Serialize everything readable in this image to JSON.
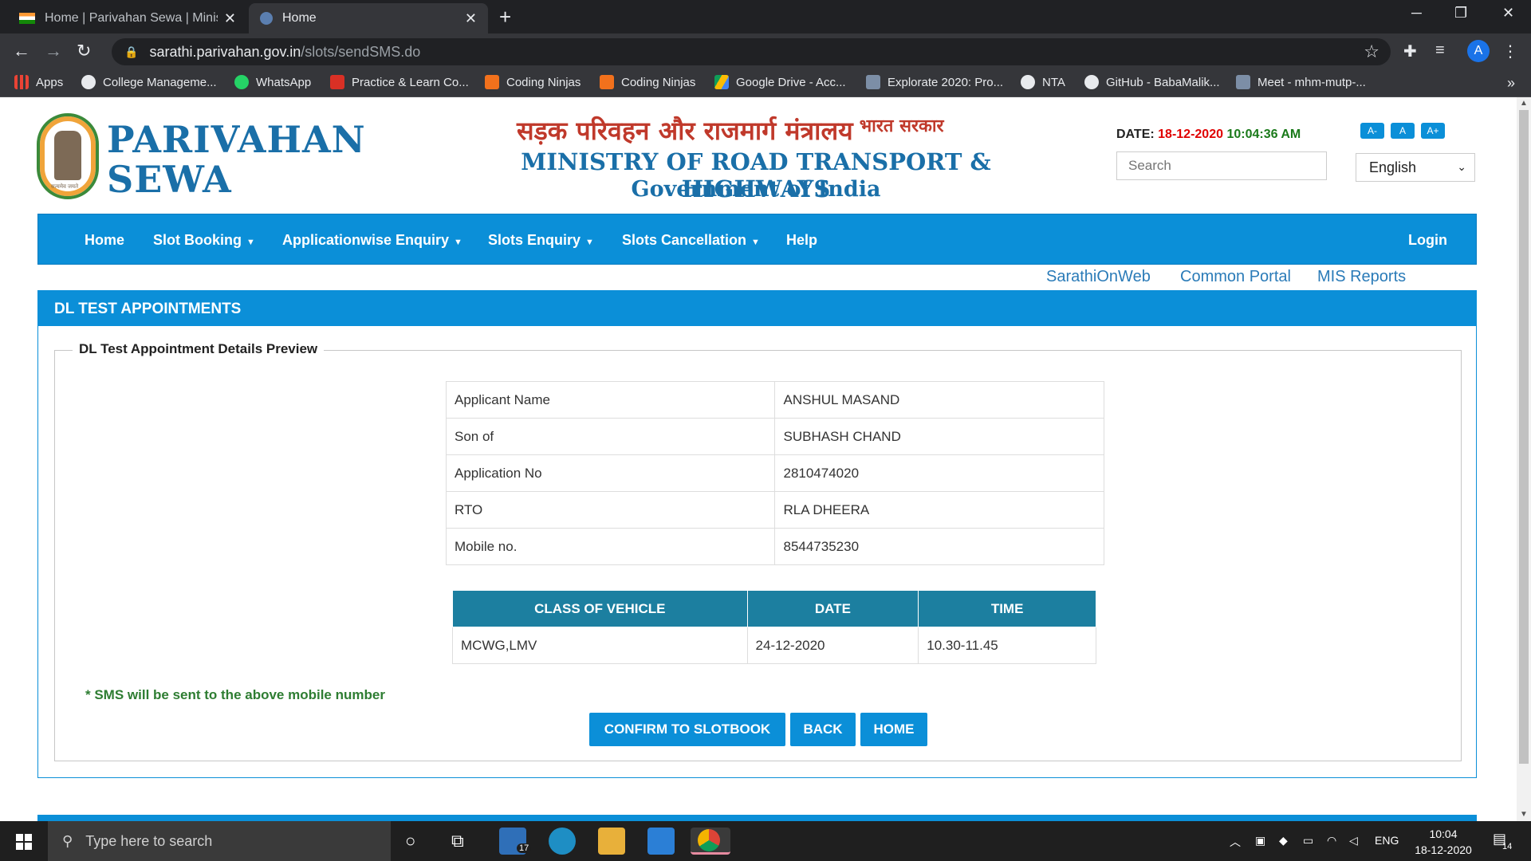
{
  "browser": {
    "tabs": [
      {
        "title": "Home | Parivahan Sewa | Ministry",
        "active": false
      },
      {
        "title": "Home",
        "active": true
      }
    ],
    "url_host": "sarathi.parivahan.gov.in",
    "url_path": "/slots/sendSMS.do",
    "avatar_letter": "A",
    "bookmarks": [
      {
        "label": "Apps",
        "color": "#ea4335"
      },
      {
        "label": "College Manageme...",
        "color": "#e8eaed"
      },
      {
        "label": "WhatsApp",
        "color": "#25d366"
      },
      {
        "label": "Practice & Learn Co...",
        "color": "#d93025"
      },
      {
        "label": "Coding Ninjas",
        "color": "#f2711c"
      },
      {
        "label": "Coding Ninjas",
        "color": "#f2711c"
      },
      {
        "label": "Google Drive - Acc...",
        "color": "#fbbc04"
      },
      {
        "label": "Explorate 2020: Pro...",
        "color": "#7c8ea6"
      },
      {
        "label": "NTA",
        "color": "#e8eaed"
      },
      {
        "label": "GitHub - BabaMalik...",
        "color": "#e8eaed"
      },
      {
        "label": "Meet - mhm-mutp-...",
        "color": "#7c8ea6"
      }
    ]
  },
  "header": {
    "brand_line1": "PARIVAHAN",
    "brand_line2": "SEWA",
    "logo_motto": "सत्यमेव जयते",
    "ministry_hindi": "सड़क परिवहन और राजमार्ग मंत्रालय",
    "ministry_hindi_small": "भारत सरकार",
    "ministry_english": "MINISTRY OF ROAD TRANSPORT & HIGHWAYS",
    "government": "Government of India",
    "date_label": "DATE:",
    "date_value": "18-12-2020",
    "time_value": "10:04:36 AM",
    "font_buttons": [
      "A-",
      "A",
      "A+"
    ],
    "search_placeholder": "Search",
    "language": "English"
  },
  "nav": {
    "items": [
      {
        "label": "Home",
        "dropdown": false
      },
      {
        "label": "Slot Booking",
        "dropdown": true
      },
      {
        "label": "Applicationwise Enquiry",
        "dropdown": true
      },
      {
        "label": "Slots Enquiry",
        "dropdown": true
      },
      {
        "label": "Slots Cancellation",
        "dropdown": true
      },
      {
        "label": "Help",
        "dropdown": false
      }
    ],
    "login": "Login",
    "sublinks": [
      "SarathiOnWeb",
      "Common Portal",
      "MIS Reports"
    ]
  },
  "panel": {
    "title": "DL TEST APPOINTMENTS",
    "legend": "DL Test Appointment Details Preview",
    "details": [
      {
        "label": "Applicant Name",
        "value": "ANSHUL MASAND"
      },
      {
        "label": "Son of",
        "value": "SUBHASH CHAND"
      },
      {
        "label": "Application No",
        "value": "2810474020"
      },
      {
        "label": "RTO",
        "value": "RLA DHEERA"
      },
      {
        "label": "Mobile no.",
        "value": "8544735230"
      }
    ],
    "slot_headers": [
      "CLASS OF VEHICLE",
      "DATE",
      "TIME"
    ],
    "slot_row": [
      "MCWG,LMV",
      "24-12-2020",
      "10.30-11.45"
    ],
    "sms_note": "* SMS will be sent to the above mobile number",
    "buttons": {
      "confirm": "CONFIRM TO SLOTBOOK",
      "back": "BACK",
      "home": "HOME"
    }
  },
  "taskbar": {
    "search_placeholder": "Type here to search",
    "mail_badge": "17",
    "lang": "ENG",
    "time": "10:04",
    "date": "18-12-2020",
    "notif_count": "14"
  }
}
